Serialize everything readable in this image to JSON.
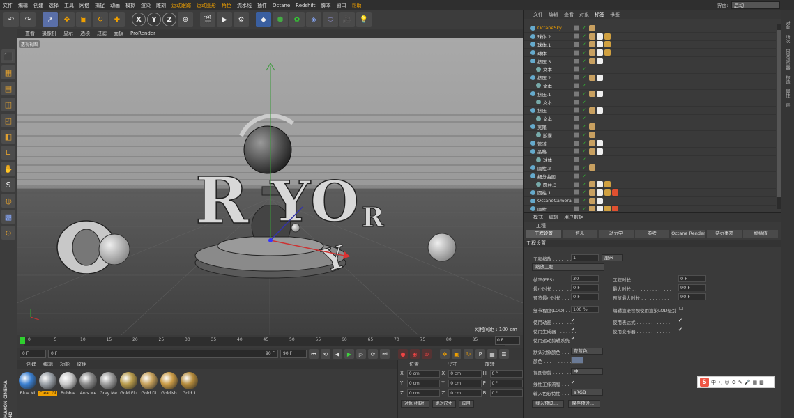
{
  "menubar": {
    "items": [
      "文件",
      "编辑",
      "创建",
      "选择",
      "工具",
      "网格",
      "捕捉",
      "动画",
      "模拟",
      "渲染",
      "雕刻",
      "运动跟踪",
      "运动图形",
      "角色",
      "流水线",
      "插件",
      "Octane",
      "Redshift",
      "脚本",
      "窗口",
      "帮助"
    ],
    "layout_label": "界面:",
    "layout_value": "启动"
  },
  "toolbar": {
    "icons": [
      "undo-icon",
      "redo-icon",
      "select-arrow-icon",
      "move-icon",
      "scale-icon",
      "rotate-icon",
      "add-icon",
      "x-axis-icon",
      "y-axis-icon",
      "z-axis-icon",
      "world-coords-icon",
      "render-view-icon",
      "render-picture-icon",
      "render-settings-icon",
      "cube-icon",
      "subdivision-icon",
      "cloner-icon",
      "deformer-icon",
      "scene-icon",
      "camera-icon",
      "light-icon"
    ],
    "axis_labels": [
      "X",
      "Y",
      "Z"
    ]
  },
  "viewport": {
    "menu": [
      "查看",
      "摄像机",
      "显示",
      "选项",
      "过滤",
      "面板",
      "ProRender"
    ],
    "camera_label": "透视视图",
    "grid_info": "网格间距 : 100 cm"
  },
  "timeline": {
    "ticks": [
      "0",
      "5",
      "10",
      "15",
      "20",
      "25",
      "30",
      "35",
      "40",
      "45",
      "50",
      "55",
      "60",
      "65",
      "70",
      "75",
      "80",
      "85",
      "90"
    ],
    "end_frame": "0 F"
  },
  "transport": {
    "start": "0 F",
    "current": "0 F",
    "end_range": "90 F",
    "end": "90 F"
  },
  "materials": {
    "menu": [
      "创建",
      "编辑",
      "功能",
      "纹理"
    ],
    "items": [
      {
        "label": "Blue Mi",
        "color": "#3a7fd0",
        "selected": false
      },
      {
        "label": "Clear Gl",
        "color": "#9aa0a6",
        "selected": true
      },
      {
        "label": "Bubble",
        "color": "#c9c9c9",
        "selected": false
      },
      {
        "label": "Anis Me",
        "color": "#8a8a8a",
        "selected": false
      },
      {
        "label": "Grey Me",
        "color": "#9b9b9b",
        "selected": false
      },
      {
        "label": "Gold Flu",
        "color": "#b79a4a",
        "selected": false
      },
      {
        "label": "Gold Di",
        "color": "#c6a05a",
        "selected": false
      },
      {
        "label": "Goldish",
        "color": "#c99a45",
        "selected": false
      },
      {
        "label": "Gold 1",
        "color": "#b48a3a",
        "selected": false
      }
    ]
  },
  "coords": {
    "headers": [
      "位置",
      "尺寸",
      "旋转"
    ],
    "rows": [
      {
        "a": "X",
        "pos": "0 cm",
        "b": "X",
        "size": "0 cm",
        "c": "H",
        "rot": "0 °"
      },
      {
        "a": "Y",
        "pos": "0 cm",
        "b": "Y",
        "size": "0 cm",
        "c": "P",
        "rot": "0 °"
      },
      {
        "a": "Z",
        "pos": "0 cm",
        "b": "Z",
        "size": "0 cm",
        "c": "B",
        "rot": "0 °"
      }
    ],
    "mode": "对象 (相对)",
    "size_mode": "绝对尺寸",
    "apply": "应用"
  },
  "object_manager": {
    "menu": [
      "文件",
      "编辑",
      "查看",
      "对象",
      "标签",
      "书签"
    ],
    "objects": [
      {
        "name": "OctaneSky",
        "indent": 0,
        "selected": true,
        "tags": 1
      },
      {
        "name": "球体.2",
        "indent": 0,
        "selected": false,
        "tags": 3
      },
      {
        "name": "球体.1",
        "indent": 0,
        "selected": false,
        "tags": 3
      },
      {
        "name": "球体",
        "indent": 0,
        "selected": false,
        "tags": 3
      },
      {
        "name": "挤压.3",
        "indent": 0,
        "selected": false,
        "tags": 2
      },
      {
        "name": "文本",
        "indent": 1,
        "selected": false,
        "tags": 0
      },
      {
        "name": "挤压.2",
        "indent": 0,
        "selected": false,
        "tags": 2
      },
      {
        "name": "文本",
        "indent": 1,
        "selected": false,
        "tags": 0
      },
      {
        "name": "挤压.1",
        "indent": 0,
        "selected": false,
        "tags": 2
      },
      {
        "name": "文本",
        "indent": 1,
        "selected": false,
        "tags": 0
      },
      {
        "name": "挤压",
        "indent": 0,
        "selected": false,
        "tags": 2
      },
      {
        "name": "文本",
        "indent": 1,
        "selected": false,
        "tags": 0
      },
      {
        "name": "克隆",
        "indent": 0,
        "selected": false,
        "tags": 1
      },
      {
        "name": "胶囊",
        "indent": 1,
        "selected": false,
        "tags": 1
      },
      {
        "name": "管道",
        "indent": 0,
        "selected": false,
        "tags": 2
      },
      {
        "name": "晶格",
        "indent": 0,
        "selected": false,
        "tags": 2
      },
      {
        "name": "球体",
        "indent": 1,
        "selected": false,
        "tags": 0
      },
      {
        "name": "圆柱.2",
        "indent": 0,
        "selected": false,
        "tags": 1
      },
      {
        "name": "细分曲面",
        "indent": 0,
        "selected": false,
        "tags": 0
      },
      {
        "name": "圆柱.3",
        "indent": 1,
        "selected": false,
        "tags": 3
      },
      {
        "name": "圆柱.1",
        "indent": 0,
        "selected": false,
        "tags": 4
      },
      {
        "name": "OctaneCamera",
        "indent": 0,
        "selected": false,
        "tags": 2
      },
      {
        "name": "圆柱",
        "indent": 0,
        "selected": false,
        "tags": 4
      }
    ]
  },
  "attributes": {
    "menu": [
      "模式",
      "编辑",
      "用户数据"
    ],
    "title": "工程",
    "tabs": [
      "工程设置",
      "信息",
      "动力学",
      "参考",
      "Octane Render",
      "待办事项",
      "帧插值"
    ],
    "section": "工程设置",
    "scale_label": "工程缩放 . . . . . . .",
    "scale_value": "1",
    "scale_unit": "厘米",
    "scale_button": "缩放工程...",
    "fps_label": "帧率(FPS) . . . . . .",
    "fps_value": "30",
    "time_label": "工程时长 . . . . . . . . . . . . . .",
    "time_value": "0 F",
    "min_label": "最小时长 . . . . . . .",
    "min_value": "0 F",
    "max_label": "最大时长 . . . . . . . . . . . . . .",
    "max_value": "90 F",
    "pmin_label": "预览最小时长 . . .",
    "pmin_value": "0 F",
    "pmax_label": "预览最大时长 . . . . . . . . . . .",
    "pmax_value": "90 F",
    "lod_label": "细节程度(LOD) . . .",
    "lod_value": "100 %",
    "lod_check_label": "编辑渲染检视使用渲染LOD级别",
    "anim_label": "使用动画 . . . . . . . .",
    "expr_label": "使用表达式 . . . . . . . . . . . .",
    "gen_label": "使用生成器 . . . . . . .",
    "deform_label": "使用变形器 . . . . . . . . . . . .",
    "motion_label": "使用运动剪辑系统",
    "color_label": "默认对象颜色 . . .",
    "color_value": "灰蓝色",
    "color2_label": "颜色 . . . . . . . . . . . . .",
    "view_label": "视图修剪 . . . . . . .",
    "view_value": "中",
    "linear_label": "线性工作流程 . . .",
    "input_label": "输入色彩特性 . . .",
    "input_value": "sRGB",
    "load_btn": "载入预设...",
    "save_btn": "保存预设..."
  },
  "right_strip": [
    "对象",
    "场次",
    "内容浏览器",
    "构造",
    "属性",
    "层"
  ],
  "ime": {
    "logo": "S",
    "text": "中"
  },
  "branding": "MAXON CINEMA 4D"
}
